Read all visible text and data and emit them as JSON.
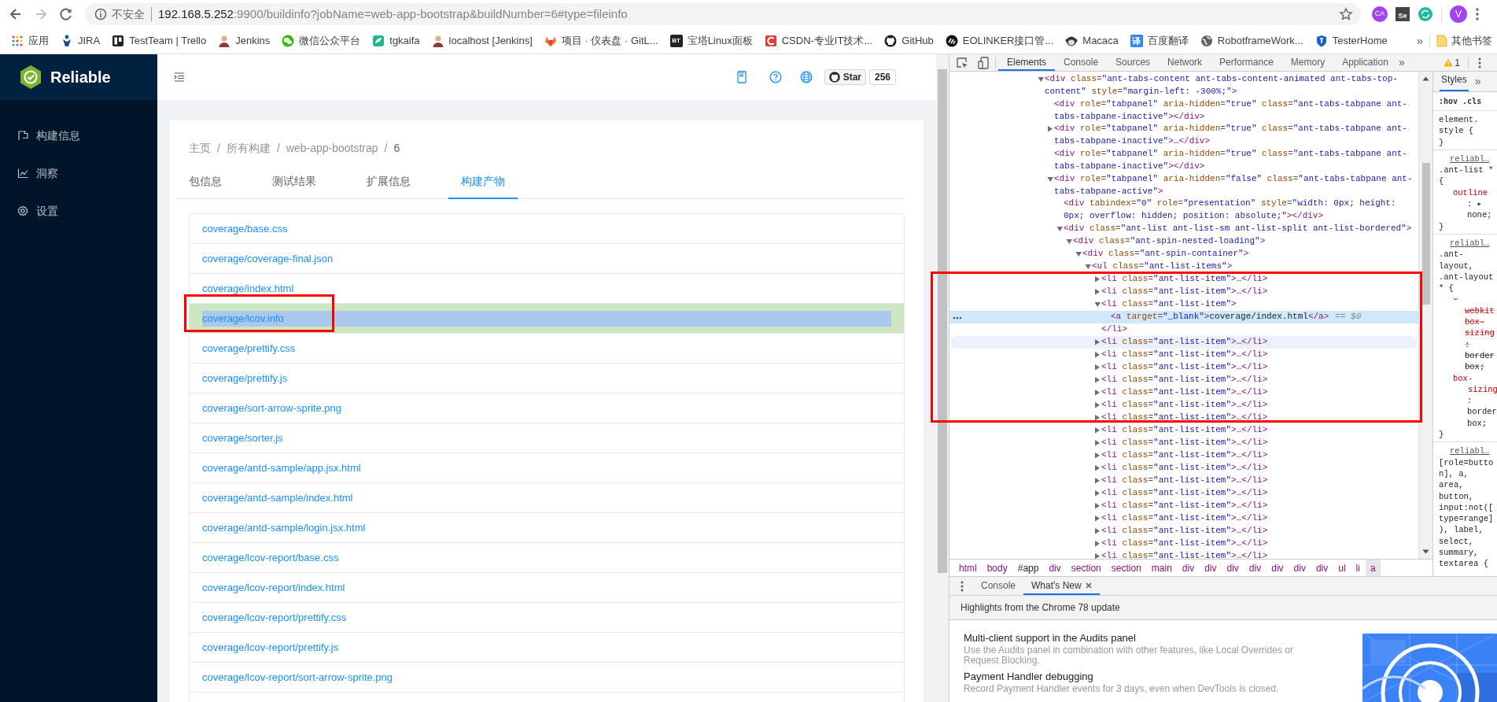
{
  "browser": {
    "security_label": "不安全",
    "url": {
      "host": "192.168.5.252",
      "path": ":9900/buildinfo?jobName=web-app-bootstrap&buildNumber=6#type=fileinfo"
    },
    "extensions": [
      {
        "kind": "circle",
        "label": "CA"
      },
      {
        "kind": "square",
        "label": "Se"
      },
      {
        "kind": "sync"
      }
    ],
    "profile": "V",
    "bookmarks": [
      {
        "kind": "apps",
        "label": "应用"
      },
      {
        "kind": "figure",
        "label": "JIRA"
      },
      {
        "kind": "board",
        "label": "TestTeam | Trello"
      },
      {
        "kind": "person",
        "label": "Jenkins"
      },
      {
        "kind": "chat",
        "label": "微信公众平台"
      },
      {
        "kind": "leaf",
        "label": "tgkaifa"
      },
      {
        "kind": "person",
        "label": "localhost [Jenkins]"
      },
      {
        "kind": "fox",
        "label": "项目 · 仪表盘 · GitL..."
      },
      {
        "kind": "text",
        "logo": "BT",
        "label": "宝塔Linux面板"
      },
      {
        "kind": "arc",
        "label": "CSDN-专业IT技术..."
      },
      {
        "kind": "cat",
        "label": "GitHub"
      },
      {
        "kind": "dashes",
        "label": "EOLINKER接口管..."
      },
      {
        "kind": "monkey",
        "label": "Macaca"
      },
      {
        "kind": "text",
        "logo": "译",
        "label": "百度翻译"
      },
      {
        "kind": "globe",
        "label": "RobotframeWork..."
      },
      {
        "kind": "shield",
        "label": "TesterHome"
      }
    ],
    "bookmarks_overflow": "»",
    "other_bookmarks": "其他书签"
  },
  "sidebar": {
    "app_name": "Reliable",
    "items": [
      {
        "kind": "flag",
        "label": "构建信息"
      },
      {
        "kind": "chart",
        "label": "洞察"
      },
      {
        "kind": "gear",
        "label": "设置"
      }
    ]
  },
  "header": {
    "github": {
      "label": "Star",
      "count": "256"
    }
  },
  "breadcrumb": [
    {
      "label": "主页",
      "separator": "/"
    },
    {
      "label": "所有构建",
      "separator": "/"
    },
    {
      "label": "web-app-bootstrap",
      "separator": "/"
    },
    {
      "label": "6"
    }
  ],
  "tabs": [
    {
      "label": "包信息",
      "selected": false
    },
    {
      "label": "测试结果",
      "selected": false
    },
    {
      "label": "扩展信息",
      "selected": false
    },
    {
      "label": "构建产物",
      "selected": true
    }
  ],
  "files": [
    {
      "name": "coverage/base.css",
      "highlighted": false
    },
    {
      "name": "coverage/coverage-final.json",
      "highlighted": false
    },
    {
      "name": "coverage/index.html",
      "highlighted": false
    },
    {
      "name": "coverage/lcov.info",
      "highlighted": true
    },
    {
      "name": "coverage/prettify.css",
      "highlighted": false
    },
    {
      "name": "coverage/prettify.js",
      "highlighted": false
    },
    {
      "name": "coverage/sort-arrow-sprite.png",
      "highlighted": false
    },
    {
      "name": "coverage/sorter.js",
      "highlighted": false
    },
    {
      "name": "coverage/antd-sample/app.jsx.html",
      "highlighted": false
    },
    {
      "name": "coverage/antd-sample/index.html",
      "highlighted": false
    },
    {
      "name": "coverage/antd-sample/login.jsx.html",
      "highlighted": false
    },
    {
      "name": "coverage/lcov-report/base.css",
      "highlighted": false
    },
    {
      "name": "coverage/lcov-report/index.html",
      "highlighted": false
    },
    {
      "name": "coverage/lcov-report/prettify.css",
      "highlighted": false
    },
    {
      "name": "coverage/lcov-report/prettify.js",
      "highlighted": false
    },
    {
      "name": "coverage/lcov-report/sort-arrow-sprite.png",
      "highlighted": false
    }
  ],
  "devtools": {
    "tabs": [
      {
        "label": "Elements",
        "selected": true
      },
      {
        "label": "Console",
        "selected": false
      },
      {
        "label": "Sources",
        "selected": false
      },
      {
        "label": "Network",
        "selected": false
      },
      {
        "label": "Performance",
        "selected": false
      },
      {
        "label": "Memory",
        "selected": false
      },
      {
        "label": "Application",
        "selected": false
      }
    ],
    "tabs_overflow": "»",
    "warnings": "1",
    "dom_tree": [
      {
        "open": "<div class=\"ant-tabs-content ant-tabs-content-animated ant-tabs-top-content\" style=\"margin-left: -300%;\">",
        "expandable": true,
        "expanded": true,
        "selected": false,
        "hovered": false,
        "children": [
          {
            "open": "<div role=\"tabpanel\" aria-hidden=\"true\" class=\"ant-tabs-tabpane ant-tabs-tabpane-inactive\"></div>",
            "expandable": false,
            "expanded": false,
            "selected": false,
            "hovered": false
          },
          {
            "open": "<div role=\"tabpanel\" aria-hidden=\"true\" class=\"ant-tabs-tabpane ant-tabs-tabpane-inactive\">…</div>",
            "expandable": true,
            "expanded": false,
            "selected": false,
            "hovered": false
          },
          {
            "open": "<div role=\"tabpanel\" aria-hidden=\"true\" class=\"ant-tabs-tabpane ant-tabs-tabpane-inactive\"></div>",
            "expandable": false,
            "expanded": false,
            "selected": false,
            "hovered": false
          },
          {
            "open": "<div role=\"tabpanel\" aria-hidden=\"false\" class=\"ant-tabs-tabpane ant-tabs-tabpane-active\">",
            "expandable": true,
            "expanded": true,
            "selected": false,
            "hovered": false,
            "children": [
              {
                "open": "<div tabindex=\"0\" role=\"presentation\" style=\"width: 0px; height: 0px; overflow: hidden; position: absolute;\"></div>",
                "expandable": false,
                "expanded": false,
                "selected": false,
                "hovered": false
              },
              {
                "open": "<div class=\"ant-list ant-list-sm ant-list-split ant-list-bordered\">",
                "expandable": true,
                "expanded": true,
                "selected": false,
                "hovered": false,
                "children": [
                  {
                    "open": "<div class=\"ant-spin-nested-loading\">",
                    "expandable": true,
                    "expanded": true,
                    "selected": false,
                    "hovered": false,
                    "children": [
                      {
                        "open": "<div class=\"ant-spin-container\">",
                        "expandable": true,
                        "expanded": true,
                        "selected": false,
                        "hovered": false,
                        "children": [
                          {
                            "open": "<ul class=\"ant-list-items\">",
                            "expandable": true,
                            "expanded": true,
                            "selected": false,
                            "hovered": false,
                            "children": [
                              {
                                "open": "<li class=\"ant-list-item\">…</li>",
                                "expandable": true,
                                "expanded": false,
                                "selected": false,
                                "hovered": false
                              },
                              {
                                "open": "<li class=\"ant-list-item\">…</li>",
                                "expandable": true,
                                "expanded": false,
                                "selected": false,
                                "hovered": false
                              },
                              {
                                "open": "<li class=\"ant-list-item\">",
                                "expandable": true,
                                "expanded": true,
                                "selected": false,
                                "hovered": false,
                                "close": "</li>",
                                "children": [
                                  {
                                    "open": "<a target=\"_blank\">coverage/index.html</a>",
                                    "expandable": false,
                                    "expanded": false,
                                    "selected": true,
                                    "hovered": false,
                                    "reference": "== $0"
                                  }
                                ]
                              },
                              {
                                "open": "<li class=\"ant-list-item\">…</li>",
                                "expandable": true,
                                "expanded": false,
                                "selected": false,
                                "hovered": true
                              },
                              {
                                "open": "<li class=\"ant-list-item\">…</li>",
                                "expandable": true,
                                "expanded": false,
                                "selected": false,
                                "hovered": false
                              },
                              {
                                "open": "<li class=\"ant-list-item\">…</li>",
                                "expandable": true,
                                "expanded": false,
                                "selected": false,
                                "hovered": false
                              },
                              {
                                "open": "<li class=\"ant-list-item\">…</li>",
                                "expandable": true,
                                "expanded": false,
                                "selected": false,
                                "hovered": false
                              },
                              {
                                "open": "<li class=\"ant-list-item\">…</li>",
                                "expandable": true,
                                "expanded": false,
                                "selected": false,
                                "hovered": false
                              },
                              {
                                "open": "<li class=\"ant-list-item\">…</li>",
                                "expandable": true,
                                "expanded": false,
                                "selected": false,
                                "hovered": false
                              },
                              {
                                "open": "<li class=\"ant-list-item\">…</li>",
                                "expandable": true,
                                "expanded": false,
                                "selected": false,
                                "hovered": false
                              },
                              {
                                "open": "<li class=\"ant-list-item\">…</li>",
                                "expandable": true,
                                "expanded": false,
                                "selected": false,
                                "hovered": false
                              },
                              {
                                "open": "<li class=\"ant-list-item\">…</li>",
                                "expandable": true,
                                "expanded": false,
                                "selected": false,
                                "hovered": false
                              },
                              {
                                "open": "<li class=\"ant-list-item\">…</li>",
                                "expandable": true,
                                "expanded": false,
                                "selected": false,
                                "hovered": false
                              },
                              {
                                "open": "<li class=\"ant-list-item\">…</li>",
                                "expandable": true,
                                "expanded": false,
                                "selected": false,
                                "hovered": false
                              },
                              {
                                "open": "<li class=\"ant-list-item\">…</li>",
                                "expandable": true,
                                "expanded": false,
                                "selected": false,
                                "hovered": false
                              },
                              {
                                "open": "<li class=\"ant-list-item\">…</li>",
                                "expandable": true,
                                "expanded": false,
                                "selected": false,
                                "hovered": false
                              },
                              {
                                "open": "<li class=\"ant-list-item\">…</li>",
                                "expandable": true,
                                "expanded": false,
                                "selected": false,
                                "hovered": false
                              },
                              {
                                "open": "<li class=\"ant-list-item\">…</li>",
                                "expandable": true,
                                "expanded": false,
                                "selected": false,
                                "hovered": false
                              },
                              {
                                "open": "<li class=\"ant-list-item\">…</li>",
                                "expandable": true,
                                "expanded": false,
                                "selected": false,
                                "hovered": false
                              },
                              {
                                "open": "<li class=\"ant-list-item\">…</li>",
                                "expandable": true,
                                "expanded": false,
                                "selected": false,
                                "hovered": false
                              },
                              {
                                "open": "<li class=\"ant-list-item\">…</li>",
                                "expandable": true,
                                "expanded": false,
                                "selected": false,
                                "hovered": false
                              }
                            ]
                          }
                        ]
                      }
                    ]
                  }
                ]
              }
            ]
          }
        ]
      }
    ],
    "path": [
      {
        "kind": "tag",
        "label": "html",
        "selected": false
      },
      {
        "kind": "tag",
        "label": "body",
        "selected": false
      },
      {
        "kind": "id",
        "label": "#app",
        "selected": false
      },
      {
        "kind": "tag",
        "label": "div",
        "selected": false
      },
      {
        "kind": "tag",
        "label": "section",
        "selected": false
      },
      {
        "kind": "tag",
        "label": "section",
        "selected": false
      },
      {
        "kind": "tag",
        "label": "main",
        "selected": false
      },
      {
        "kind": "tag",
        "label": "div",
        "selected": false
      },
      {
        "kind": "tag",
        "label": "div",
        "selected": false
      },
      {
        "kind": "tag",
        "label": "div",
        "selected": false
      },
      {
        "kind": "tag",
        "label": "div",
        "selected": false
      },
      {
        "kind": "tag",
        "label": "div",
        "selected": false
      },
      {
        "kind": "tag",
        "label": "div",
        "selected": false
      },
      {
        "kind": "tag",
        "label": "div",
        "selected": false
      },
      {
        "kind": "tag",
        "label": "ul",
        "selected": false
      },
      {
        "kind": "tag",
        "label": "li",
        "selected": false
      },
      {
        "kind": "tag",
        "label": "a",
        "selected": true
      }
    ],
    "styles": {
      "tab": "Styles",
      "overflow": "»",
      "filters": [
        ":hov",
        ".cls"
      ],
      "lines": [
        {
          "kind": "selector",
          "text": "element."
        },
        {
          "kind": "selector",
          "text": "style {"
        },
        {
          "kind": "brace",
          "text": "}"
        },
        {
          "kind": "source",
          "text": "reliabl…"
        },
        {
          "kind": "selector",
          "text": ".ant-list *"
        },
        {
          "kind": "brace",
          "text": "{"
        },
        {
          "kind": "property",
          "text": "outline"
        },
        {
          "kind": "value",
          "text": ": ▸"
        },
        {
          "kind": "value",
          "text": "none;"
        },
        {
          "kind": "brace",
          "text": "}"
        },
        {
          "kind": "source",
          "text": "reliabl…"
        },
        {
          "kind": "selector",
          "text": ".ant-"
        },
        {
          "kind": "selector",
          "text": "layout,"
        },
        {
          "kind": "selector",
          "text": ".ant-layout"
        },
        {
          "kind": "selector",
          "text": "* {"
        },
        {
          "kind": "overridden_property",
          "text": "-"
        },
        {
          "kind": "overridden_property_wrap",
          "text": "webkit"
        },
        {
          "kind": "overridden_property_wrap",
          "text": "box-"
        },
        {
          "kind": "overridden_property_wrap",
          "text": "sizing"
        },
        {
          "kind": "overridden_value",
          "text": ":"
        },
        {
          "kind": "overridden_value",
          "text": "border"
        },
        {
          "kind": "overridden_value",
          "text": "box;"
        },
        {
          "kind": "property",
          "text": "box-"
        },
        {
          "kind": "property_wrap",
          "text": "sizing"
        },
        {
          "kind": "value",
          "text": ":"
        },
        {
          "kind": "value",
          "text": "border"
        },
        {
          "kind": "value",
          "text": "box;"
        },
        {
          "kind": "brace",
          "text": "}"
        },
        {
          "kind": "source",
          "text": "reliabl…"
        },
        {
          "kind": "selector",
          "text": "[role=butto"
        },
        {
          "kind": "selector",
          "text": "n], a,"
        },
        {
          "kind": "selector",
          "text": "area,"
        },
        {
          "kind": "selector",
          "text": "button,"
        },
        {
          "kind": "selector",
          "text": "input:not(["
        },
        {
          "kind": "selector",
          "text": "type=range]"
        },
        {
          "kind": "selector",
          "text": "), label,"
        },
        {
          "kind": "selector",
          "text": "select,"
        },
        {
          "kind": "selector",
          "text": "summary,"
        },
        {
          "kind": "selector",
          "text": "textarea {"
        }
      ]
    },
    "drawer": {
      "tabs": [
        {
          "label": "Console",
          "selected": false,
          "closable": false
        },
        {
          "label": "What's New",
          "selected": true,
          "closable": true
        }
      ],
      "heading": "Highlights from the Chrome 78 update",
      "items": [
        {
          "title": "Multi-client support in the Audits panel",
          "description": "Use the Audits panel in combination with other features, like Local Overrides or Request Blocking."
        },
        {
          "title": "Payment Handler debugging",
          "description": "Record Payment Handler events for 3 days, even when DevTools is closed."
        }
      ]
    }
  }
}
